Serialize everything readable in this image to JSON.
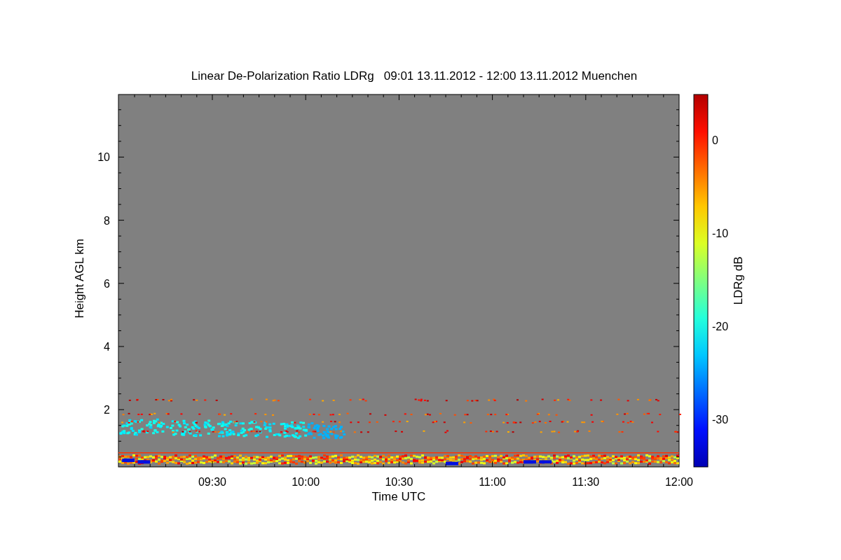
{
  "title": "Linear De-Polarization Ratio LDRg   09:01 13.11.2012 - 12:00 13.11.2012 Muenchen",
  "x_axis": {
    "label": "Time UTC",
    "ticks": [
      "09:30",
      "10:00",
      "10:30",
      "11:00",
      "11:30",
      "12:00"
    ]
  },
  "y_axis": {
    "label": "Height AGL km",
    "ticks": [
      "10",
      "8",
      "6",
      "4",
      "2"
    ]
  },
  "colorbar": {
    "label": "LDRg dB",
    "ticks": [
      "0",
      "-10",
      "-20",
      "-30"
    ]
  }
}
